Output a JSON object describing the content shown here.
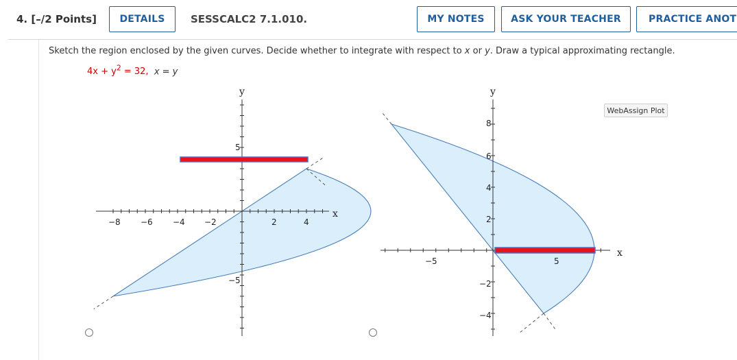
{
  "header": {
    "question_number": "4.",
    "points": "[–/2 Points]",
    "details_label": "DETAILS",
    "problem_code": "SESSCALC2 7.1.010.",
    "my_notes_label": "MY NOTES",
    "ask_teacher_label": "ASK YOUR TEACHER",
    "practice_label": "PRACTICE ANOTHER"
  },
  "question": {
    "prompt_pre": "Sketch the region enclosed by the given curves. Decide whether to integrate with respect to ",
    "var_x": "x",
    "prompt_or": " or ",
    "var_y": "y",
    "prompt_post": ". Draw a typical approximating rectangle.",
    "eq_a": "4x + y",
    "eq_sup": "2",
    "eq_b": " = 32,",
    "eq_c": "x = y"
  },
  "plot_badge": "WebAssign Plot",
  "colors": {
    "accent": "#1f5f9e",
    "region_fill": "#dbeefc",
    "region_stroke": "#4a7fb8",
    "rect": "#e8141b"
  },
  "choices": [
    {
      "id": "left-graph",
      "selected": false,
      "chart_data": {
        "type": "area",
        "curves": [
          "4x + y^2 = 32",
          "x = y"
        ],
        "xlabel": "x",
        "ylabel": "y",
        "x_ticks": [
          "−8",
          "−6",
          "−4",
          "−2",
          "2",
          "4"
        ],
        "y_ticks": [
          "5",
          "−5"
        ],
        "rectangle_orientation": "horizontal"
      }
    },
    {
      "id": "right-graph",
      "selected": false,
      "chart_data": {
        "type": "area",
        "curves": [
          "4x + y^2 = 32",
          "x = y"
        ],
        "xlabel": "x",
        "ylabel": "y",
        "x_ticks": [
          "−5",
          "5"
        ],
        "y_ticks": [
          "8",
          "6",
          "4",
          "2",
          "−2",
          "−4"
        ],
        "rectangle_orientation": "horizontal"
      }
    }
  ]
}
